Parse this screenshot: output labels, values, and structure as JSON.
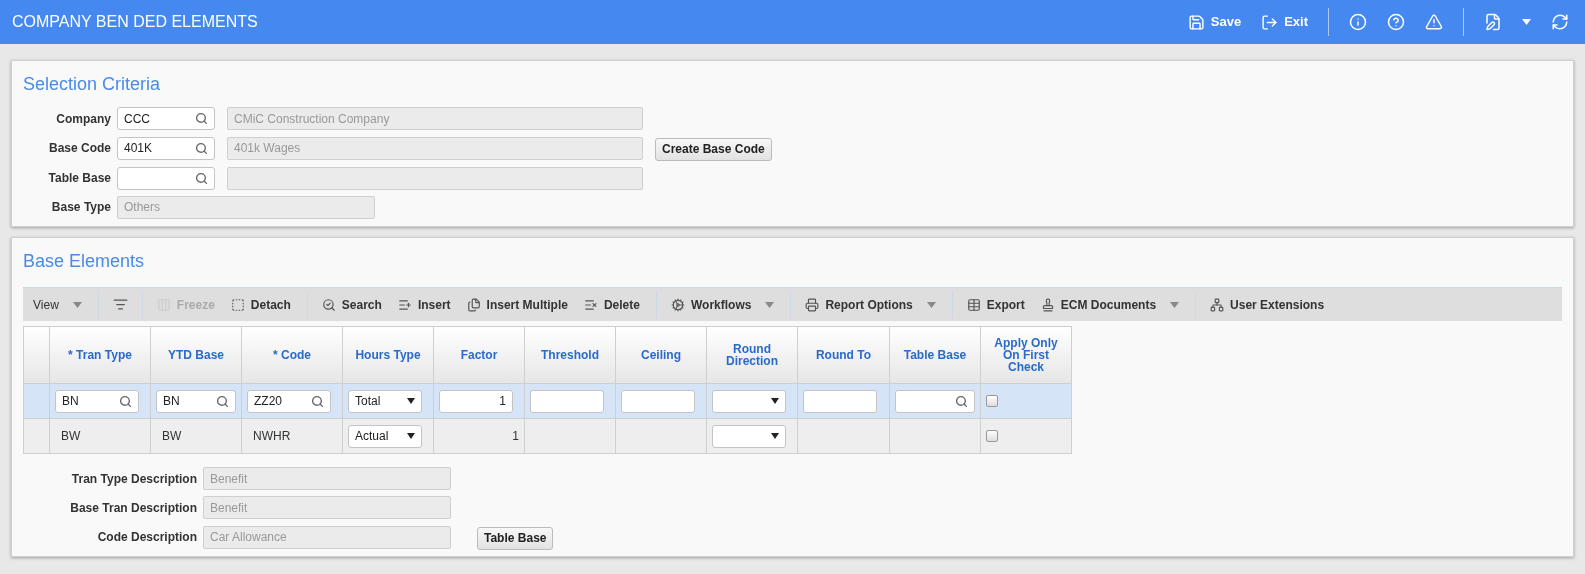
{
  "header": {
    "title": "COMPANY BEN DED ELEMENTS",
    "buttons": [
      {
        "label": "Save"
      },
      {
        "label": "Exit"
      }
    ]
  },
  "selection": {
    "title": "Selection Criteria",
    "fields": [
      {
        "kind": "lookup",
        "label": "Company",
        "value": "CCC",
        "description": "CMiC Construction Company"
      },
      {
        "kind": "lookup",
        "label": "Base Code",
        "value": "401K",
        "description": "401k Wages",
        "button": "Create Base Code"
      },
      {
        "kind": "lookup",
        "label": "Table Base"
      },
      {
        "kind": "readonly",
        "label": "Base Type",
        "value": "Others"
      }
    ]
  },
  "base_elements": {
    "title": "Base Elements",
    "toolbar": [
      {
        "label": "View",
        "disabled": false,
        "dropdown": true
      },
      {
        "label": "Freeze",
        "disabled": true,
        "dropdown": false
      },
      {
        "label": "Detach",
        "disabled": false,
        "dropdown": false
      },
      {
        "label": "Search",
        "disabled": false,
        "dropdown": false
      },
      {
        "label": "Insert",
        "disabled": false,
        "dropdown": false
      },
      {
        "label": "Insert Multiple",
        "disabled": false,
        "dropdown": false
      },
      {
        "label": "Delete",
        "disabled": false,
        "dropdown": false
      },
      {
        "label": "Workflows",
        "disabled": false,
        "dropdown": true
      },
      {
        "label": "Report Options",
        "disabled": false,
        "dropdown": true
      },
      {
        "label": "Export",
        "disabled": false,
        "dropdown": false
      },
      {
        "label": "ECM Documents",
        "disabled": false,
        "dropdown": true
      },
      {
        "label": "User Extensions",
        "disabled": false,
        "dropdown": false
      }
    ],
    "table": {
      "columns": [
        "* Tran Type",
        "YTD Base",
        "* Code",
        "Hours Type",
        "Factor",
        "Threshold",
        "Ceiling",
        "Round Direction",
        "Round To",
        "Table Base",
        "Apply Only On First Check"
      ],
      "rows": [
        {
          "selected": true,
          "cells": [
            {
              "kind": "lookup",
              "value": "BN"
            },
            {
              "kind": "lookup",
              "value": "BN"
            },
            {
              "kind": "lookup",
              "value": "ZZ20"
            },
            {
              "kind": "select",
              "value": "Total"
            },
            {
              "kind": "input",
              "value": "1"
            },
            {
              "kind": "input"
            },
            {
              "kind": "input"
            },
            {
              "kind": "select"
            },
            {
              "kind": "input"
            },
            {
              "kind": "lookup"
            },
            {
              "kind": "checkbox",
              "checked": false
            }
          ]
        },
        {
          "selected": false,
          "cells": [
            {
              "kind": "text",
              "value": "BW"
            },
            {
              "kind": "text",
              "value": "BW"
            },
            {
              "kind": "text",
              "value": "NWHR"
            },
            {
              "kind": "select",
              "value": "Actual"
            },
            {
              "kind": "number",
              "value": "1"
            },
            {
              "kind": "blank"
            },
            {
              "kind": "blank"
            },
            {
              "kind": "select"
            },
            {
              "kind": "blank"
            },
            {
              "kind": "blank"
            },
            {
              "kind": "checkbox",
              "checked": false
            }
          ]
        }
      ]
    },
    "details": [
      {
        "label": "Tran Type Description",
        "value": "Benefit"
      },
      {
        "label": "Base Tran Description",
        "value": "Benefit"
      },
      {
        "label": "Code Description",
        "value": "Car Allowance",
        "button": "Table Base"
      }
    ]
  }
}
